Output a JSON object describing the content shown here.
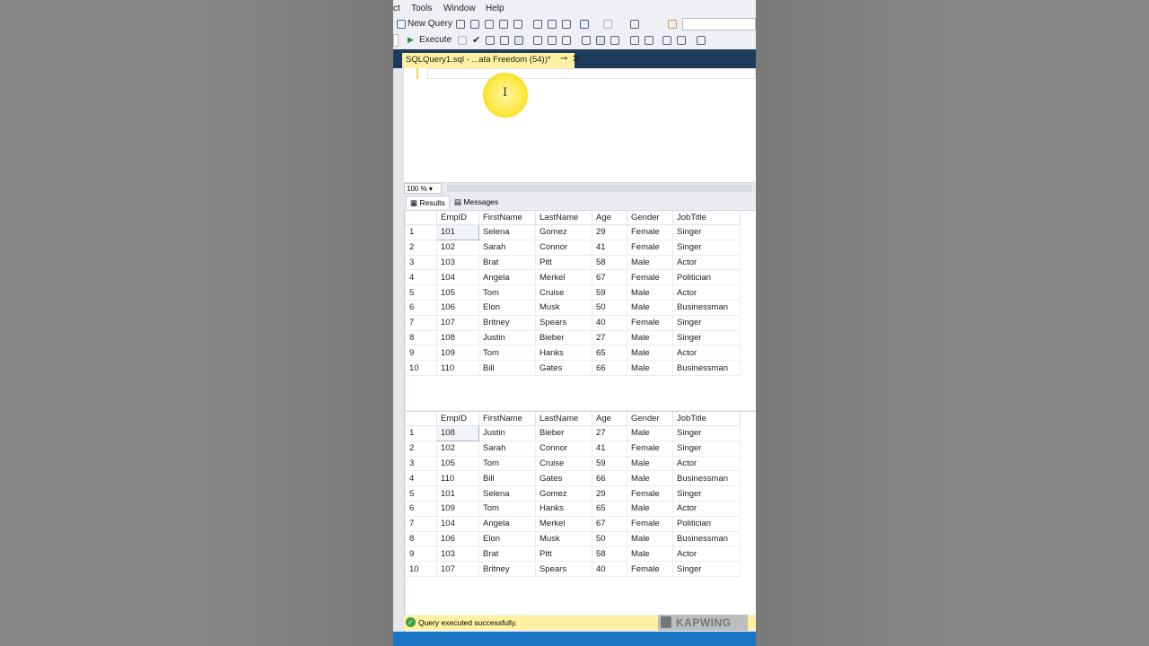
{
  "menu": [
    "ct",
    "Tools",
    "Window",
    "Help"
  ],
  "toolbar": {
    "new_query_label": "New Query",
    "execute_label": "Execute"
  },
  "document_tab": {
    "title": "SQLQuery1.sql - ...ata Freedom (54))*",
    "pin": "⊸",
    "close": "✕"
  },
  "editor": {
    "ibeam": "I"
  },
  "zoom": "100 %",
  "result_tabs": [
    {
      "label": "Results",
      "active": true
    },
    {
      "label": "Messages",
      "active": false
    }
  ],
  "columns": [
    "EmpID",
    "FirstName",
    "LastName",
    "Age",
    "Gender",
    "JobTitle"
  ],
  "grid1": [
    [
      "1",
      "101",
      "Selena",
      "Gomez",
      "29",
      "Female",
      "Singer"
    ],
    [
      "2",
      "102",
      "Sarah",
      "Connor",
      "41",
      "Female",
      "Singer"
    ],
    [
      "3",
      "103",
      "Brat",
      "Pitt",
      "58",
      "Male",
      "Actor"
    ],
    [
      "4",
      "104",
      "Angela",
      "Merkel",
      "67",
      "Female",
      "Politician"
    ],
    [
      "5",
      "105",
      "Tom",
      "Cruise",
      "59",
      "Male",
      "Actor"
    ],
    [
      "6",
      "106",
      "Elon",
      "Musk",
      "50",
      "Male",
      "Businessman"
    ],
    [
      "7",
      "107",
      "Britney",
      "Spears",
      "40",
      "Female",
      "Singer"
    ],
    [
      "8",
      "108",
      "Justin",
      "Bieber",
      "27",
      "Male",
      "Singer"
    ],
    [
      "9",
      "109",
      "Tom",
      "Hanks",
      "65",
      "Male",
      "Actor"
    ],
    [
      "10",
      "110",
      "Bill",
      "Gates",
      "66",
      "Male",
      "Businessman"
    ]
  ],
  "grid2": [
    [
      "1",
      "108",
      "Justin",
      "Bieber",
      "27",
      "Male",
      "Singer"
    ],
    [
      "2",
      "102",
      "Sarah",
      "Connor",
      "41",
      "Female",
      "Singer"
    ],
    [
      "3",
      "105",
      "Tom",
      "Cruise",
      "59",
      "Male",
      "Actor"
    ],
    [
      "4",
      "110",
      "Bill",
      "Gates",
      "66",
      "Male",
      "Businessman"
    ],
    [
      "5",
      "101",
      "Selena",
      "Gomez",
      "29",
      "Female",
      "Singer"
    ],
    [
      "6",
      "109",
      "Tom",
      "Hanks",
      "65",
      "Male",
      "Actor"
    ],
    [
      "7",
      "104",
      "Angela",
      "Merkel",
      "67",
      "Female",
      "Politician"
    ],
    [
      "8",
      "106",
      "Elon",
      "Musk",
      "50",
      "Male",
      "Businessman"
    ],
    [
      "9",
      "103",
      "Brat",
      "Pitt",
      "58",
      "Male",
      "Actor"
    ],
    [
      "10",
      "107",
      "Britney",
      "Spears",
      "40",
      "Female",
      "Singer"
    ]
  ],
  "status": {
    "message": "Query executed successfully.",
    "icon": "check-icon"
  },
  "watermark": "KAPWING",
  "colors": {
    "tab_highlight": "#fff1a1",
    "tabstrip": "#1f3b5c",
    "bottom_bar": "#1a75c4",
    "success": "#3aa345"
  }
}
